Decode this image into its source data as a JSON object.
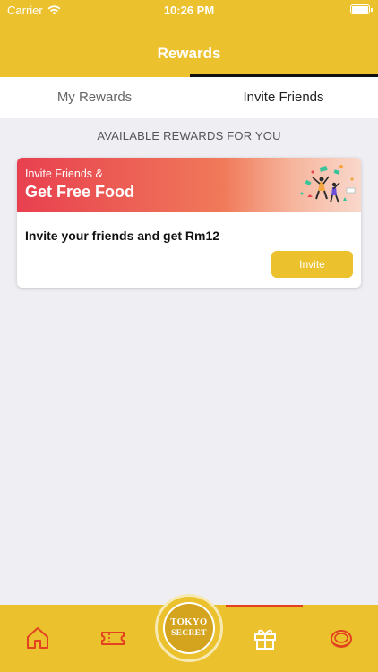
{
  "status_bar": {
    "carrier": "Carrier",
    "time": "10:26 PM"
  },
  "header": {
    "title": "Rewards"
  },
  "tabs": [
    {
      "label": "My Rewards",
      "active": false
    },
    {
      "label": "Invite Friends",
      "active": true
    }
  ],
  "section": {
    "label": "AVAILABLE REWARDS FOR YOU"
  },
  "reward_card": {
    "banner_line1": "Invite Friends &",
    "banner_line2": "Get Free Food",
    "description": "Invite your friends and get Rm12",
    "button_label": "Invite"
  },
  "tab_bar": {
    "items": [
      {
        "icon": "home-icon"
      },
      {
        "icon": "ticket-icon"
      },
      {
        "icon": "tokyo-secret-logo",
        "logo_line1": "TOKYO",
        "logo_line2": "SECRET"
      },
      {
        "icon": "gift-icon",
        "active": true
      },
      {
        "icon": "tart-icon"
      }
    ]
  },
  "colors": {
    "brand_yellow": "#ecc12e",
    "accent_red": "#e2421f",
    "banner_start": "#e8404f",
    "background": "#efeef3"
  }
}
